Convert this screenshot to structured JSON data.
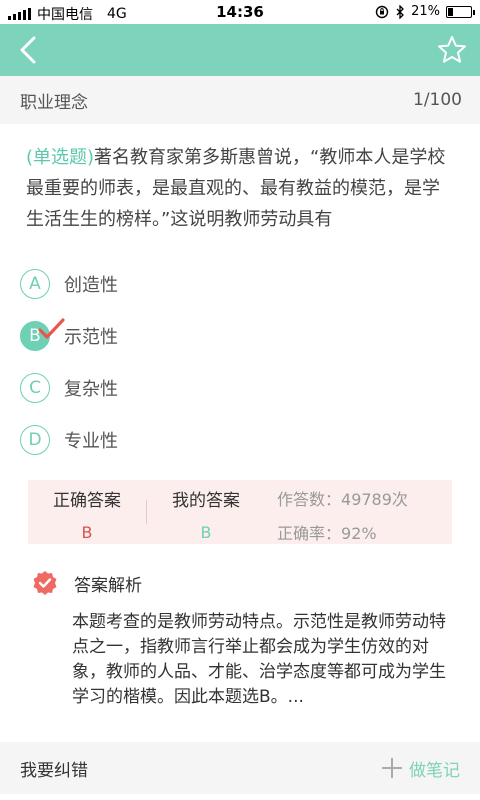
{
  "status_bar": {
    "carrier": "中国电信",
    "network": "4G",
    "time": "14:36",
    "battery": "21%",
    "battery_level": 0.21
  },
  "nav": {
    "back_icon": "chevron-left-icon",
    "favorite_icon": "star-outline-icon"
  },
  "header": {
    "category": "职业理念",
    "progress": "1/100"
  },
  "question": {
    "type_label": "(单选题)",
    "text": "著名教育家第多斯惠曾说，“教师本人是学校最重要的师表，是最直观的、最有教益的模范，是学生活生生的榜样。”这说明教师劳动具有"
  },
  "options": [
    {
      "letter": "A",
      "text": "创造性"
    },
    {
      "letter": "B",
      "text": "示范性"
    },
    {
      "letter": "C",
      "text": "复杂性"
    },
    {
      "letter": "D",
      "text": "专业性"
    }
  ],
  "answer": {
    "correct_label": "正确答案",
    "correct_value": "B",
    "mine_label": "我的答案",
    "mine_value": "B",
    "attempts_label": "作答数：",
    "attempts_value": "49789次",
    "accuracy_label": "正确率：",
    "accuracy_value": "92%"
  },
  "analysis": {
    "title": "答案解析",
    "body": "本题考查的是教师劳动特点。示范性是教师劳动特点之一，指教师言行举止都会成为学生仿效的对象，教师的人品、才能、治学态度等都可成为学生学习的楷模。因此本题选B。..."
  },
  "footer": {
    "report_error": "我要纠错",
    "take_note": "做笔记"
  },
  "colors": {
    "accent": "#7dd3bb",
    "correct_answer": "#d9534f",
    "my_answer": "#6ed0b5",
    "answer_panel_bg": "#fdeeee"
  }
}
